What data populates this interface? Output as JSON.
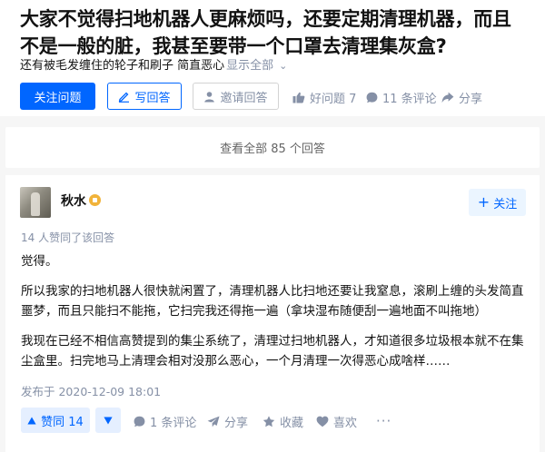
{
  "question": {
    "title": "大家不觉得扫地机器人更麻烦吗，还要定期清理机器，而且不是一般的脏，我甚至要带一个口罩去清理集灰盒?",
    "description": "还有被毛发缠住的轮子和刷子 简直恶心",
    "show_all": "显示全部",
    "buttons": {
      "follow": "关注问题",
      "write": "写回答",
      "invite": "邀请回答",
      "good_question": "好问题 7",
      "comments": "11 条评论",
      "share": "分享"
    }
  },
  "view_all": "查看全部 85 个回答",
  "answer": {
    "author": "秋水",
    "follow": "关注",
    "upvote_info": "14 人赞同了该回答",
    "paragraphs": [
      "觉得。",
      "所以我家的扫地机器人很快就闲置了，清理机器人比扫地还要让我窒息，滚刷上缠的头发简直噩梦，而且只能扫不能拖，它扫完我还得拖一遍（拿块湿布随便刮一遍地面不叫拖地）",
      "我现在已经不相信高赞提到的集尘系统了，清理过扫地机器人，才知道很多垃圾根本就不在集尘盒里。扫完地马上清理会相对没那么恶心，一个月清理一次得恶心成啥样……"
    ],
    "published": "发布于 2020-12-09 18:01",
    "actions": {
      "upvote": "赞同 14",
      "comments": "1 条评论",
      "share": "分享",
      "favorite": "收藏",
      "like": "喜欢"
    }
  },
  "colors": {
    "brand": "#0066ff",
    "muted": "#8590a6",
    "page_bg": "#f6f6f6"
  }
}
